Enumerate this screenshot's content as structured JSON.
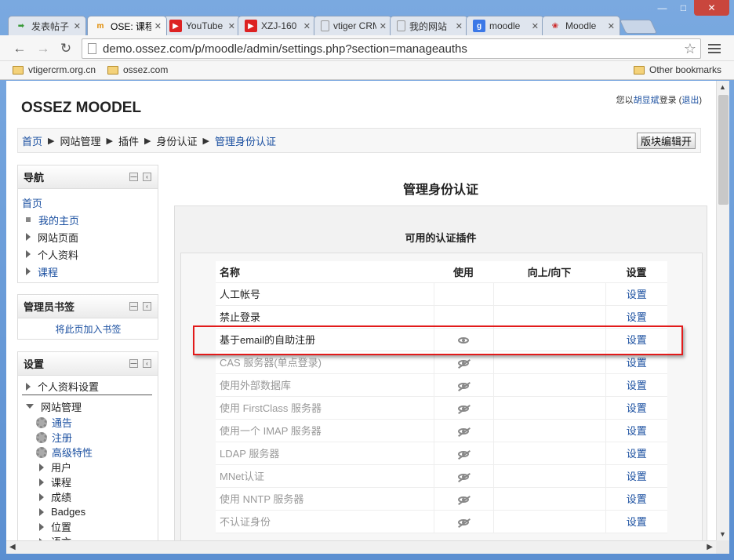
{
  "browser": {
    "tabs": [
      {
        "title": "发表帖子",
        "icon": "green-arrow-icon"
      },
      {
        "title": "OSE: 课程",
        "icon": "moodle-icon"
      },
      {
        "title": "YouTube",
        "icon": "youtube-icon"
      },
      {
        "title": "XZJ-160",
        "icon": "youtube-icon"
      },
      {
        "title": "vtiger CRM",
        "icon": "page-icon"
      },
      {
        "title": "我的网站",
        "icon": "page-icon"
      },
      {
        "title": "moodle",
        "icon": "google-icon"
      },
      {
        "title": "Moodle",
        "icon": "moodle-red-icon"
      }
    ],
    "active_tab": 1,
    "url": "demo.ossez.com/p/moodle/admin/settings.php?section=manageauths",
    "bookmarks": [
      "vtigercrm.org.cn",
      "ossez.com"
    ],
    "other_bookmarks": "Other bookmarks"
  },
  "page": {
    "site_title": "OSSEZ MOODEL",
    "login_prefix": "您以",
    "login_user": "胡显斌",
    "login_mid": "登录 (",
    "logout": "退出",
    "login_suffix": ")",
    "breadcrumb": [
      "首页",
      "网站管理",
      "插件",
      "身份认证",
      "管理身份认证"
    ],
    "edit_block_button": "版块编辑开",
    "nav_block": {
      "title": "导航",
      "home": "首页",
      "items": [
        "我的主页",
        "网站页面",
        "个人资料",
        "课程"
      ]
    },
    "admin_bookmarks_block": {
      "title": "管理员书签",
      "link": "将此页加入书签"
    },
    "settings_block": {
      "title": "设置",
      "profile_settings": "个人资料设置",
      "site_admin": "网站管理",
      "gear_items": [
        "通告",
        "注册",
        "高级特性"
      ],
      "tree_items": [
        "用户",
        "课程",
        "成绩",
        "Badges",
        "位置",
        "语言"
      ]
    },
    "main": {
      "heading": "管理身份认证",
      "subheading": "可用的认证插件",
      "columns": [
        "名称",
        "使用",
        "向上/向下",
        "设置"
      ],
      "rows": [
        {
          "name": "人工帐号",
          "enabled": null,
          "settings": "设置"
        },
        {
          "name": "禁止登录",
          "enabled": null,
          "settings": "设置"
        },
        {
          "name": "基于email的自助注册",
          "enabled": true,
          "settings": "设置"
        },
        {
          "name": "CAS 服务器(单点登录)",
          "enabled": false,
          "settings": "设置"
        },
        {
          "name": "使用外部数据库",
          "enabled": false,
          "settings": "设置"
        },
        {
          "name": "使用 FirstClass 服务器",
          "enabled": false,
          "settings": "设置"
        },
        {
          "name": "使用一个 IMAP 服务器",
          "enabled": false,
          "settings": "设置"
        },
        {
          "name": "LDAP 服务器",
          "enabled": false,
          "settings": "设置"
        },
        {
          "name": "MNet认证",
          "enabled": false,
          "settings": "设置"
        },
        {
          "name": "使用 NNTP 服务器",
          "enabled": false,
          "settings": "设置"
        },
        {
          "name": "不认证身份",
          "enabled": false,
          "settings": "设置"
        }
      ]
    }
  },
  "colors": {
    "link": "#1a4fa0",
    "highlight": "#e21a1a"
  }
}
